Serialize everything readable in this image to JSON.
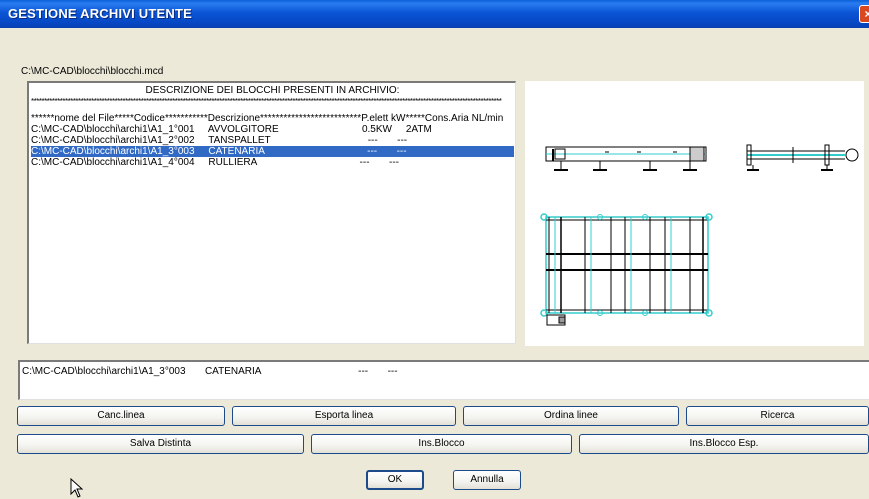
{
  "window": {
    "title": "GESTIONE ARCHIVI UTENTE",
    "close_label": "×"
  },
  "archive_path": "C:\\MC-CAD\\blocchi\\blocchi.mcd",
  "list": {
    "heading": "DESCRIZIONE DEI BLOCCHI PRESENTI IN ARCHIVIO:",
    "separator": "************************************************************************************************************************************************************************************",
    "columns": "******nome del File*****Codice***********Descrizione**************************P.elett kW*****Cons.Aria NL/min",
    "rows": [
      {
        "text": "C:\\MC-CAD\\blocchi\\archi1\\A1_1°001     AVVOLGITORE                              0.5KW     2ATM",
        "selected": false
      },
      {
        "text": "C:\\MC-CAD\\blocchi\\archi1\\A1_2°002     TANSPALLET                                   ---       ---",
        "selected": false
      },
      {
        "text": "C:\\MC-CAD\\blocchi\\archi1\\A1_3°003     CATENARIA                                     ---       ---",
        "selected": true
      },
      {
        "text": "C:\\MC-CAD\\blocchi\\archi1\\A1_4°004     RULLIERA                                     ---       ---",
        "selected": false
      }
    ]
  },
  "detail_text": "C:\\MC-CAD\\blocchi\\archi1\\A1_3°003       CATENARIA                                   ---       ---",
  "buttons": {
    "canc_linea": "Canc.linea",
    "esporta_linea": "Esporta linea",
    "ordina_linee": "Ordina linee",
    "ricerca": "Ricerca",
    "salva_distinta": "Salva Distinta",
    "ins_blocco": "Ins.Blocco",
    "ins_blocco_esp": "Ins.Blocco Esp.",
    "ok": "OK",
    "annulla": "Annulla"
  },
  "colors": {
    "title_bar": "#0a55d6",
    "selection": "#316ac5",
    "drawing_cyan": "#33cccc"
  }
}
